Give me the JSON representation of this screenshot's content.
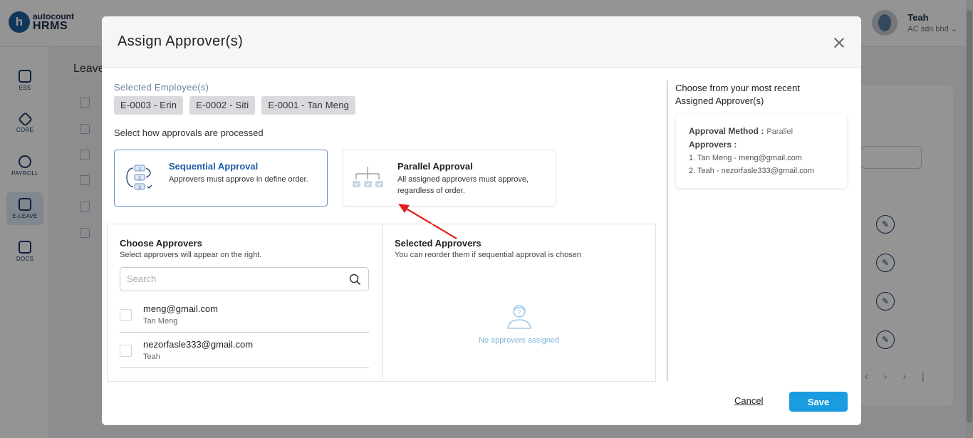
{
  "app": {
    "logo_small": "autocount",
    "logo_big": "HRMS",
    "logo_letter": "h",
    "user_name": "Teah",
    "company": "AC sdn bhd ⌄"
  },
  "sidebar": {
    "items": [
      {
        "label": "ESS",
        "icon": "ess-icon"
      },
      {
        "label": "CORE",
        "icon": "core-icon"
      },
      {
        "label": "PAYROLL",
        "icon": "payroll-icon"
      },
      {
        "label": "E-LEAVE",
        "icon": "calendar-icon",
        "active": true
      },
      {
        "label": "DOCS",
        "icon": "docs-icon"
      }
    ]
  },
  "page": {
    "title": "Leave"
  },
  "modal": {
    "title": "Assign Approver(s)",
    "selected_label": "Selected Employee(s)",
    "employees": [
      "E-0003 - Erin",
      "E-0002 - Siti",
      "E-0001 - Tan Meng"
    ],
    "method_label": "Select how approvals are processed",
    "methods": [
      {
        "title": "Sequential Approval",
        "desc": "Approvers must approve in define order.",
        "selected": true
      },
      {
        "title": "Parallel Approval",
        "desc": "All assigned approvers must approve, regardless of order.",
        "selected": false
      }
    ],
    "choose": {
      "title": "Choose Approvers",
      "subtitle": "Select approvers will appear on the right.",
      "search_placeholder": "Search",
      "approvers": [
        {
          "email": "meng@gmail.com",
          "name": "Tan Meng"
        },
        {
          "email": "nezorfasle333@gmail.com",
          "name": "Teah"
        }
      ]
    },
    "selected": {
      "title": "Selected Approvers",
      "subtitle": "You can reorder them if sequential approval is chosen",
      "empty_text": "No approvers assigned"
    },
    "recent": {
      "title": "Choose from your most recent Assigned Approver(s)",
      "method_label": "Approval Method :",
      "method_value": "Parallel",
      "approvers_label": "Approvers :",
      "approvers": [
        "1. Tan Meng - meng@gmail.com",
        "2. Teah - nezorfasle333@gmail.com"
      ]
    },
    "cancel_label": "Cancel",
    "save_label": "Save"
  },
  "colors": {
    "accent": "#1a9ce0",
    "selected_border": "#6a90c8",
    "annotation_arrow": "#e02020"
  }
}
